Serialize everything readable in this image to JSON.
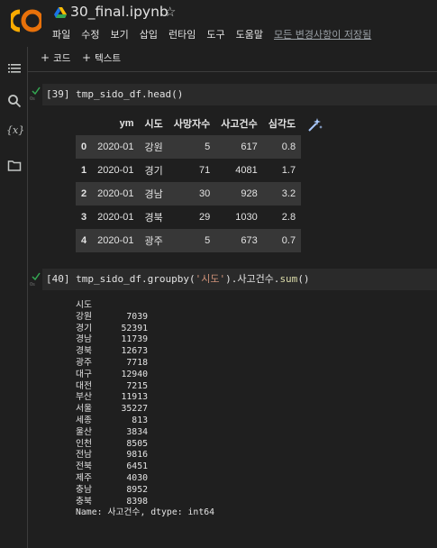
{
  "header": {
    "file_title": "30_final.ipynb",
    "menu": [
      "파일",
      "수정",
      "보기",
      "삽입",
      "런타임",
      "도구",
      "도움말"
    ],
    "saved_status": "모든 변경사항이 저장됨"
  },
  "toolbar": {
    "add_code": "코드",
    "add_text": "텍스트"
  },
  "cell1": {
    "prompt": "[39]",
    "code": "tmp_sido_df.head()",
    "exec_time": "0s"
  },
  "dataframe": {
    "columns": [
      "ym",
      "시도",
      "사망자수",
      "사고건수",
      "심각도"
    ],
    "rows": [
      {
        "index": "0",
        "ym": "2020-01",
        "sido": "강원",
        "deaths": "5",
        "accidents": "617",
        "severity": "0.8"
      },
      {
        "index": "1",
        "ym": "2020-01",
        "sido": "경기",
        "deaths": "71",
        "accidents": "4081",
        "severity": "1.7"
      },
      {
        "index": "2",
        "ym": "2020-01",
        "sido": "경남",
        "deaths": "30",
        "accidents": "928",
        "severity": "3.2"
      },
      {
        "index": "3",
        "ym": "2020-01",
        "sido": "경북",
        "deaths": "29",
        "accidents": "1030",
        "severity": "2.8"
      },
      {
        "index": "4",
        "ym": "2020-01",
        "sido": "광주",
        "deaths": "5",
        "accidents": "673",
        "severity": "0.7"
      }
    ]
  },
  "cell2": {
    "prompt": "[40]",
    "code_pre": "tmp_sido_df.groupby(",
    "code_str": "'시도'",
    "code_mid": ").사고건수.",
    "code_fn": "sum",
    "code_post": "()",
    "exec_time": "0s"
  },
  "series": {
    "index_name": "시도",
    "items": [
      {
        "k": "강원",
        "v": "7039"
      },
      {
        "k": "경기",
        "v": "52391"
      },
      {
        "k": "경남",
        "v": "11739"
      },
      {
        "k": "경북",
        "v": "12673"
      },
      {
        "k": "광주",
        "v": "7718"
      },
      {
        "k": "대구",
        "v": "12940"
      },
      {
        "k": "대전",
        "v": "7215"
      },
      {
        "k": "부산",
        "v": "11913"
      },
      {
        "k": "서울",
        "v": "35227"
      },
      {
        "k": "세종",
        "v": "813"
      },
      {
        "k": "울산",
        "v": "3834"
      },
      {
        "k": "인천",
        "v": "8505"
      },
      {
        "k": "전남",
        "v": "9816"
      },
      {
        "k": "전북",
        "v": "6451"
      },
      {
        "k": "제주",
        "v": "4030"
      },
      {
        "k": "충남",
        "v": "8952"
      },
      {
        "k": "충북",
        "v": "8398"
      }
    ],
    "footer": "Name: 사고건수, dtype: int64"
  },
  "icons": {
    "logo": "colab-logo",
    "drive": "drive-icon",
    "star": "star-icon",
    "toc": "table-of-contents-icon",
    "search": "search-icon",
    "vars": "variables-icon",
    "files": "folder-icon",
    "magic": "magic-wand-icon"
  },
  "colors": {
    "logo_orange": "#f9ab00",
    "logo_dark": "#e8710a",
    "check": "#34a853"
  }
}
